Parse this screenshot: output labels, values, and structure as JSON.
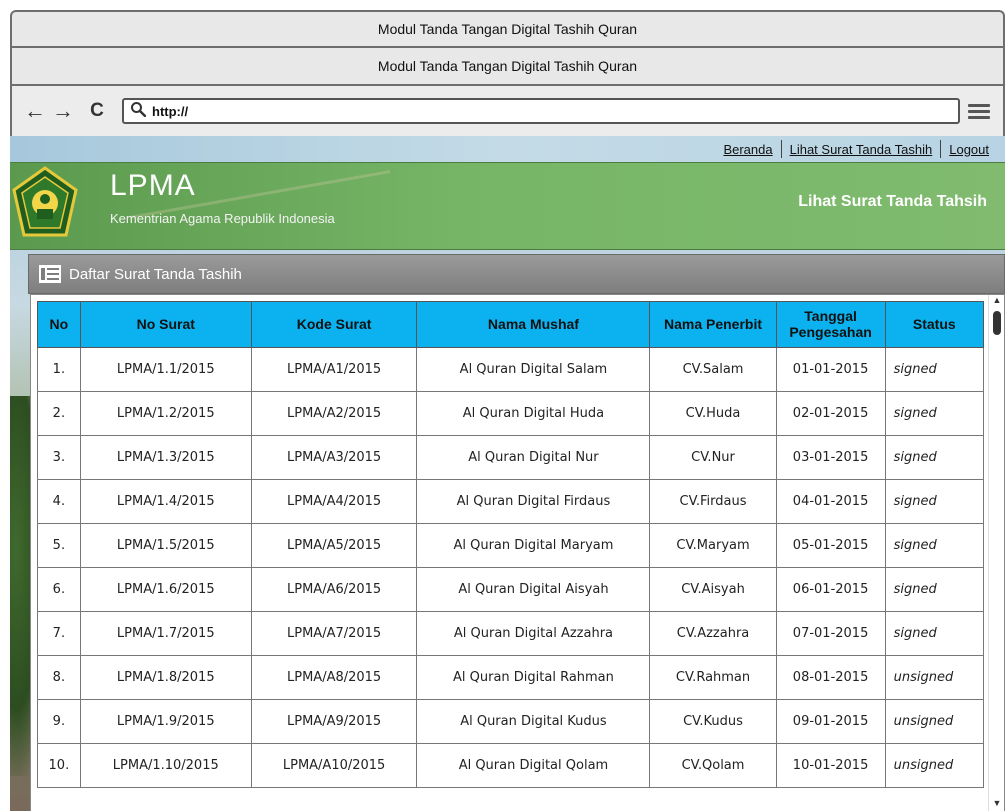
{
  "window": {
    "title": "Modul Tanda Tangan Digital Tashih Quran"
  },
  "tab": {
    "label": "Modul Tanda Tangan Digital Tashih Quran"
  },
  "navbar": {
    "url": "http://",
    "back_icon": "←",
    "forward_icon": "→",
    "reload_icon": "C",
    "search_icon": "🔍"
  },
  "topnav": {
    "links": [
      "Beranda",
      "Lihat Surat Tanda Tashih",
      "Logout"
    ]
  },
  "header": {
    "brand": "LPMA",
    "subtitle": "Kementrian Agama Republik Indonesia",
    "page_title": "Lihat Surat Tanda Tahsih"
  },
  "panel": {
    "title": "Daftar Surat Tanda Tashih"
  },
  "table": {
    "columns": [
      "No",
      "No Surat",
      "Kode Surat",
      "Nama Mushaf",
      "Nama Penerbit",
      "Tanggal Pengesahan",
      "Status"
    ],
    "rows": [
      [
        "1.",
        "LPMA/1.1/2015",
        "LPMA/A1/2015",
        "Al Quran Digital Salam",
        "CV.Salam",
        "01-01-2015",
        "signed"
      ],
      [
        "2.",
        "LPMA/1.2/2015",
        "LPMA/A2/2015",
        "Al Quran Digital Huda",
        "CV.Huda",
        "02-01-2015",
        "signed"
      ],
      [
        "3.",
        "LPMA/1.3/2015",
        "LPMA/A3/2015",
        "Al Quran Digital Nur",
        "CV.Nur",
        "03-01-2015",
        "signed"
      ],
      [
        "4.",
        "LPMA/1.4/2015",
        "LPMA/A4/2015",
        "Al Quran Digital Firdaus",
        "CV.Firdaus",
        "04-01-2015",
        "signed"
      ],
      [
        "5.",
        "LPMA/1.5/2015",
        "LPMA/A5/2015",
        "Al Quran Digital Maryam",
        "CV.Maryam",
        "05-01-2015",
        "signed"
      ],
      [
        "6.",
        "LPMA/1.6/2015",
        "LPMA/A6/2015",
        "Al Quran Digital Aisyah",
        "CV.Aisyah",
        "06-01-2015",
        "signed"
      ],
      [
        "7.",
        "LPMA/1.7/2015",
        "LPMA/A7/2015",
        "Al Quran Digital Azzahra",
        "CV.Azzahra",
        "07-01-2015",
        "signed"
      ],
      [
        "8.",
        "LPMA/1.8/2015",
        "LPMA/A8/2015",
        "Al Quran Digital Rahman",
        "CV.Rahman",
        "08-01-2015",
        "unsigned"
      ],
      [
        "9.",
        "LPMA/1.9/2015",
        "LPMA/A9/2015",
        "Al Quran Digital Kudus",
        "CV.Kudus",
        "09-01-2015",
        "unsigned"
      ],
      [
        "10.",
        "LPMA/1.10/2015",
        "LPMA/A10/2015",
        "Al Quran Digital Qolam",
        "CV.Qolam",
        "10-01-2015",
        "unsigned"
      ]
    ]
  },
  "colors": {
    "header_green": "#76b566",
    "table_header_blue": "#0bb2ef",
    "panel_gray": "#8a8a8a"
  }
}
